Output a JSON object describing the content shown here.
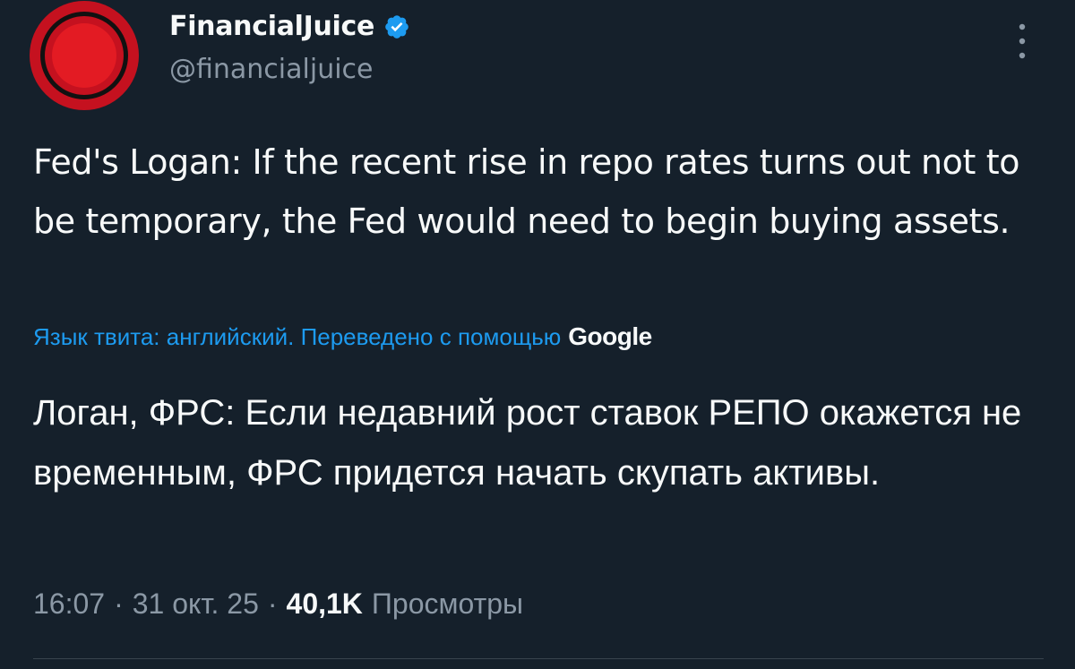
{
  "author": {
    "display_name": "FinancialJuice",
    "handle": "@financialjuice",
    "verified": true,
    "avatar_icon": "red-circle-logo-icon"
  },
  "tweet": {
    "text": "Fed's Logan: If the recent rise in repo rates turns out not to be temporary, the Fed would need to begin buying assets.",
    "translation_label": "Язык твита: английский. Переведено с помощью",
    "translation_provider": "Google",
    "translated_text": "Логан, ФРС: Если недавний рост ставок РЕПО окажется не временным, ФРС придется начать скупать активы."
  },
  "meta": {
    "time": "16:07",
    "separator": "·",
    "date": "31 окт. 25",
    "views_count": "40,1K",
    "views_label": "Просмотры"
  },
  "colors": {
    "background": "#15202b",
    "text_primary": "#f7f9f9",
    "text_secondary": "#8b98a5",
    "accent": "#1d9bf0",
    "avatar_red": "#e31b23"
  },
  "icons": {
    "verified": "verified-badge-icon",
    "more": "more-vertical-icon"
  }
}
